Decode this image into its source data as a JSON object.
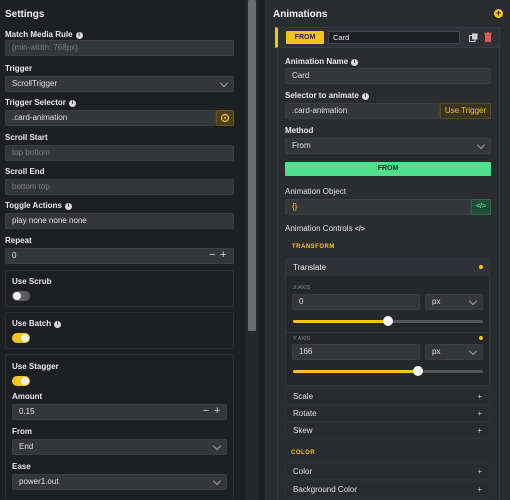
{
  "settings": {
    "title": "Settings",
    "match_media_label": "Match Media Rule",
    "match_media_placeholder": "(min-width: 768px)",
    "trigger_label": "Trigger",
    "trigger_value": "ScrollTrigger",
    "trigger_selector_label": "Trigger Selector",
    "trigger_selector_value": ".card-animation",
    "scroll_start_label": "Scroll Start",
    "scroll_start_placeholder": "top bottom",
    "scroll_end_label": "Scroll End",
    "scroll_end_placeholder": "bottom top",
    "toggle_actions_label": "Toggle Actions",
    "toggle_actions_value": "play none none none",
    "repeat_label": "Repeat",
    "repeat_value": "0",
    "use_scrub_label": "Use Scrub",
    "use_scrub_on": false,
    "use_batch_label": "Use Batch",
    "use_batch_on": true,
    "use_stagger_label": "Use Stagger",
    "use_stagger_on": true,
    "amount_label": "Amount",
    "amount_value": "0.15",
    "from_label": "From",
    "from_value": "End",
    "ease_label": "Ease",
    "ease_value": "power1.out",
    "stepper_minus": "−",
    "stepper_plus": "+"
  },
  "animations": {
    "title": "Animations",
    "tab_from_label": "FROM",
    "tab_name_value": "Card",
    "animation_name_label": "Animation Name",
    "animation_name_value": "Card",
    "selector_label": "Selector to animate",
    "selector_value": ".card-animation",
    "use_trigger_label": "Use Trigger",
    "method_label": "Method",
    "method_value": "From",
    "method_badge": "FROM",
    "animation_object_label": "Animation Object",
    "animation_object_value": "{}",
    "code_icon_glyph": "</>",
    "controls_label": "Animation Controls",
    "transform_caption": "TRANSFORM",
    "translate_label": "Translate",
    "x_axis_caption": "X AXIS",
    "x_value": "0",
    "x_unit": "px",
    "x_slider_level": 0.5,
    "y_axis_caption": "Y AXIS",
    "y_value": "166",
    "y_unit": "px",
    "y_slider_level": 0.66,
    "scale_label": "Scale",
    "rotate_label": "Rotate",
    "skew_label": "Skew",
    "color_caption": "COLOR",
    "color_label": "Color",
    "bg_color_label": "Background Color",
    "plus_glyph": "+"
  },
  "colors": {
    "accent": "#f5c518",
    "badge_green": "#4ee08a",
    "background": "#1e1f22",
    "input": "#35363a"
  }
}
